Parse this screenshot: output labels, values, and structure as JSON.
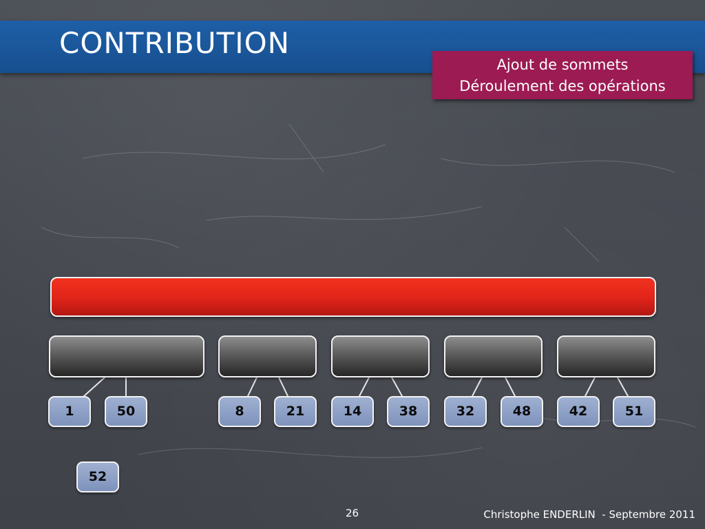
{
  "slide": {
    "title": "CONTRIBUTION",
    "subtitle_line1": "Ajout de sommets",
    "subtitle_line2": "Déroulement des opérations",
    "page_number": "26",
    "footer": "Christophe ENDERLIN  - Septembre 2011"
  },
  "diagram": {
    "leaves": [
      "1",
      "50",
      "8",
      "21",
      "14",
      "38",
      "32",
      "48",
      "42",
      "51"
    ],
    "extra_node": "52"
  },
  "colors": {
    "title_band": "#1e5fa7",
    "subtitle_box": "#9c1b53",
    "root_bar": "#e02a1c",
    "group_boxes": "#4a4a4a",
    "leaf_nodes": "#8ea1c8",
    "background": "#44474e"
  }
}
